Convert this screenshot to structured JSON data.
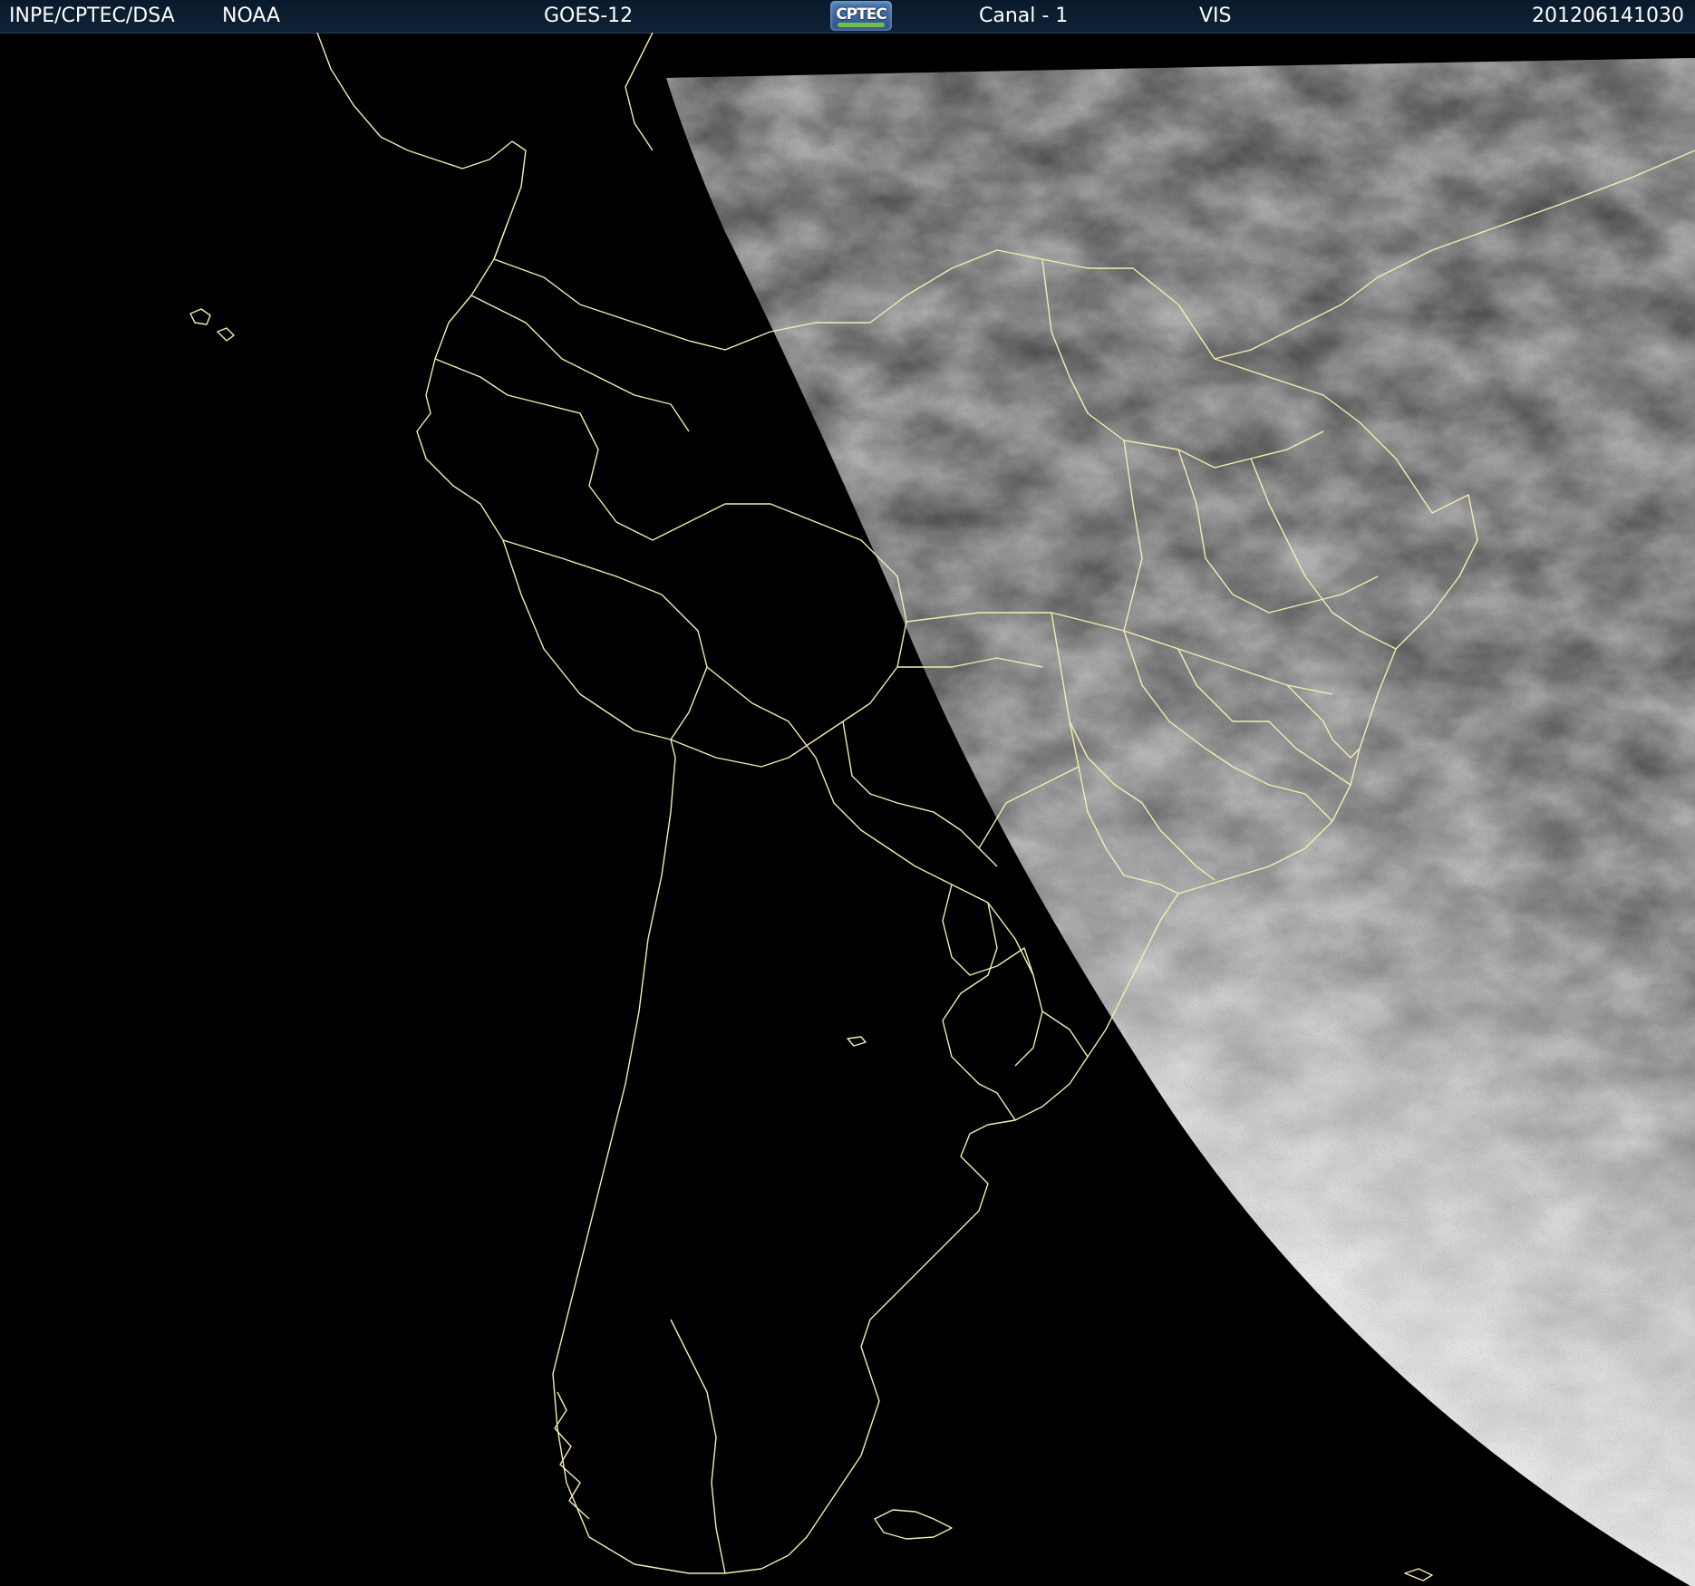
{
  "header": {
    "org": "INPE/CPTEC/DSA",
    "agency": "NOAA",
    "satellite": "GOES-12",
    "logo_text": "CPTEC",
    "channel": "Canal - 1",
    "band": "VIS",
    "timestamp": "201206141030"
  },
  "colors": {
    "background": "#000000",
    "header_background": "#0c1e32",
    "header_text": "#ffffff",
    "coastline": "#f2eeb0",
    "cloud_imagery_dark": "#3a3a3a",
    "cloud_imagery_light": "#e8e8e8"
  }
}
